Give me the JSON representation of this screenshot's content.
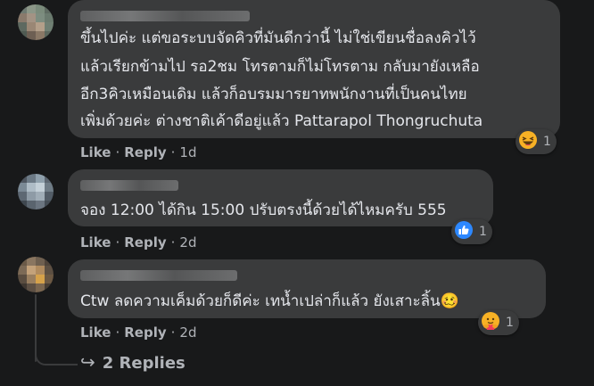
{
  "comments": [
    {
      "author_name": "",
      "lines": [
        "ขึ้นไปค่ะ แต่ขอระบบจัดคิวที่มันดีกว่านี้ ไม่ใช่เขียนชื่อลงคิวไว้",
        "แล้วเรียกข้ามไป รอ2ชม โทรตามก็ไม่โทรตาม กลับมายังเหลือ",
        "อีก3คิวเหมือนเดิม แล้วก็อบรมมารยาทพนักงานที่เป็นคนไทย",
        "เพิ่มด้วยค่ะ ต่างชาติเค้าดีอยู่แล้ว Pattarapol Thongruchuta"
      ],
      "like_label": "Like",
      "reply_label": "Reply",
      "time": "1d",
      "reaction_icon": "haha-icon",
      "reaction_count": "1"
    },
    {
      "author_name": "",
      "lines": [
        "จอง 12:00 ได้กิน 15:00 ปรับตรงนี้ด้วยได้ไหมครับ 555"
      ],
      "like_label": "Like",
      "reply_label": "Reply",
      "time": "2d",
      "reaction_icon": "like-icon",
      "reaction_count": "1"
    },
    {
      "author_name": "",
      "lines": [
        "Ctw ลดความเค็มด้วยก็ดีค่ะ เทน้ำเปล่าก็แล้ว ยังเสาะลิ้น🥴"
      ],
      "like_label": "Like",
      "reply_label": "Reply",
      "time": "2d",
      "reaction_icon": "care-icon",
      "reaction_count": "1"
    }
  ],
  "separator": "·",
  "replies_link": {
    "arrow": "↪",
    "label": "2 Replies"
  },
  "colors": {
    "background": "#18191a",
    "bubble": "#3a3b3c",
    "text": "#e4e6eb",
    "secondary_text": "#b0b3b8",
    "like_blue": "#2d88ff",
    "haha_yellow": "#f7b125"
  }
}
